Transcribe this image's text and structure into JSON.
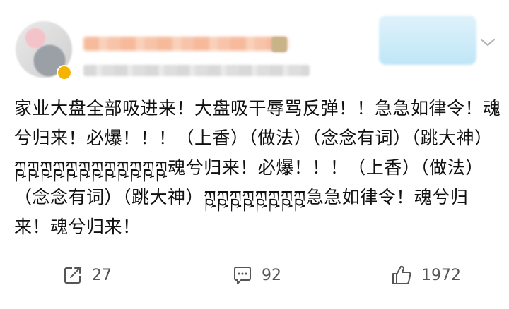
{
  "post": {
    "text": "家业大盘全部吸进来！大盘吸干辱骂反弹！！急急如律令！魂兮归来！必爆！！！（上香）（做法）（念念有词）（跳大神）ཀྵཀྵཀྵཀྵཀྵཀྵཀྵཀྵཀྵཀྵཀྵཀྵ魂兮归来！必爆！！！（上香）（做法）（念念有词）（跳大神）ཀྵཀྵཀྵཀྵཀྵཀྵཀྵཀྵ急急如律令！魂兮归来！魂兮归来！"
  },
  "actions": {
    "repost_count": "27",
    "comment_count": "92",
    "like_count": "1972"
  },
  "colors": {
    "text": "#111111",
    "icon": "#555555"
  },
  "icons": [
    "repost-icon",
    "comment-icon",
    "like-icon",
    "chevron-down-icon"
  ]
}
